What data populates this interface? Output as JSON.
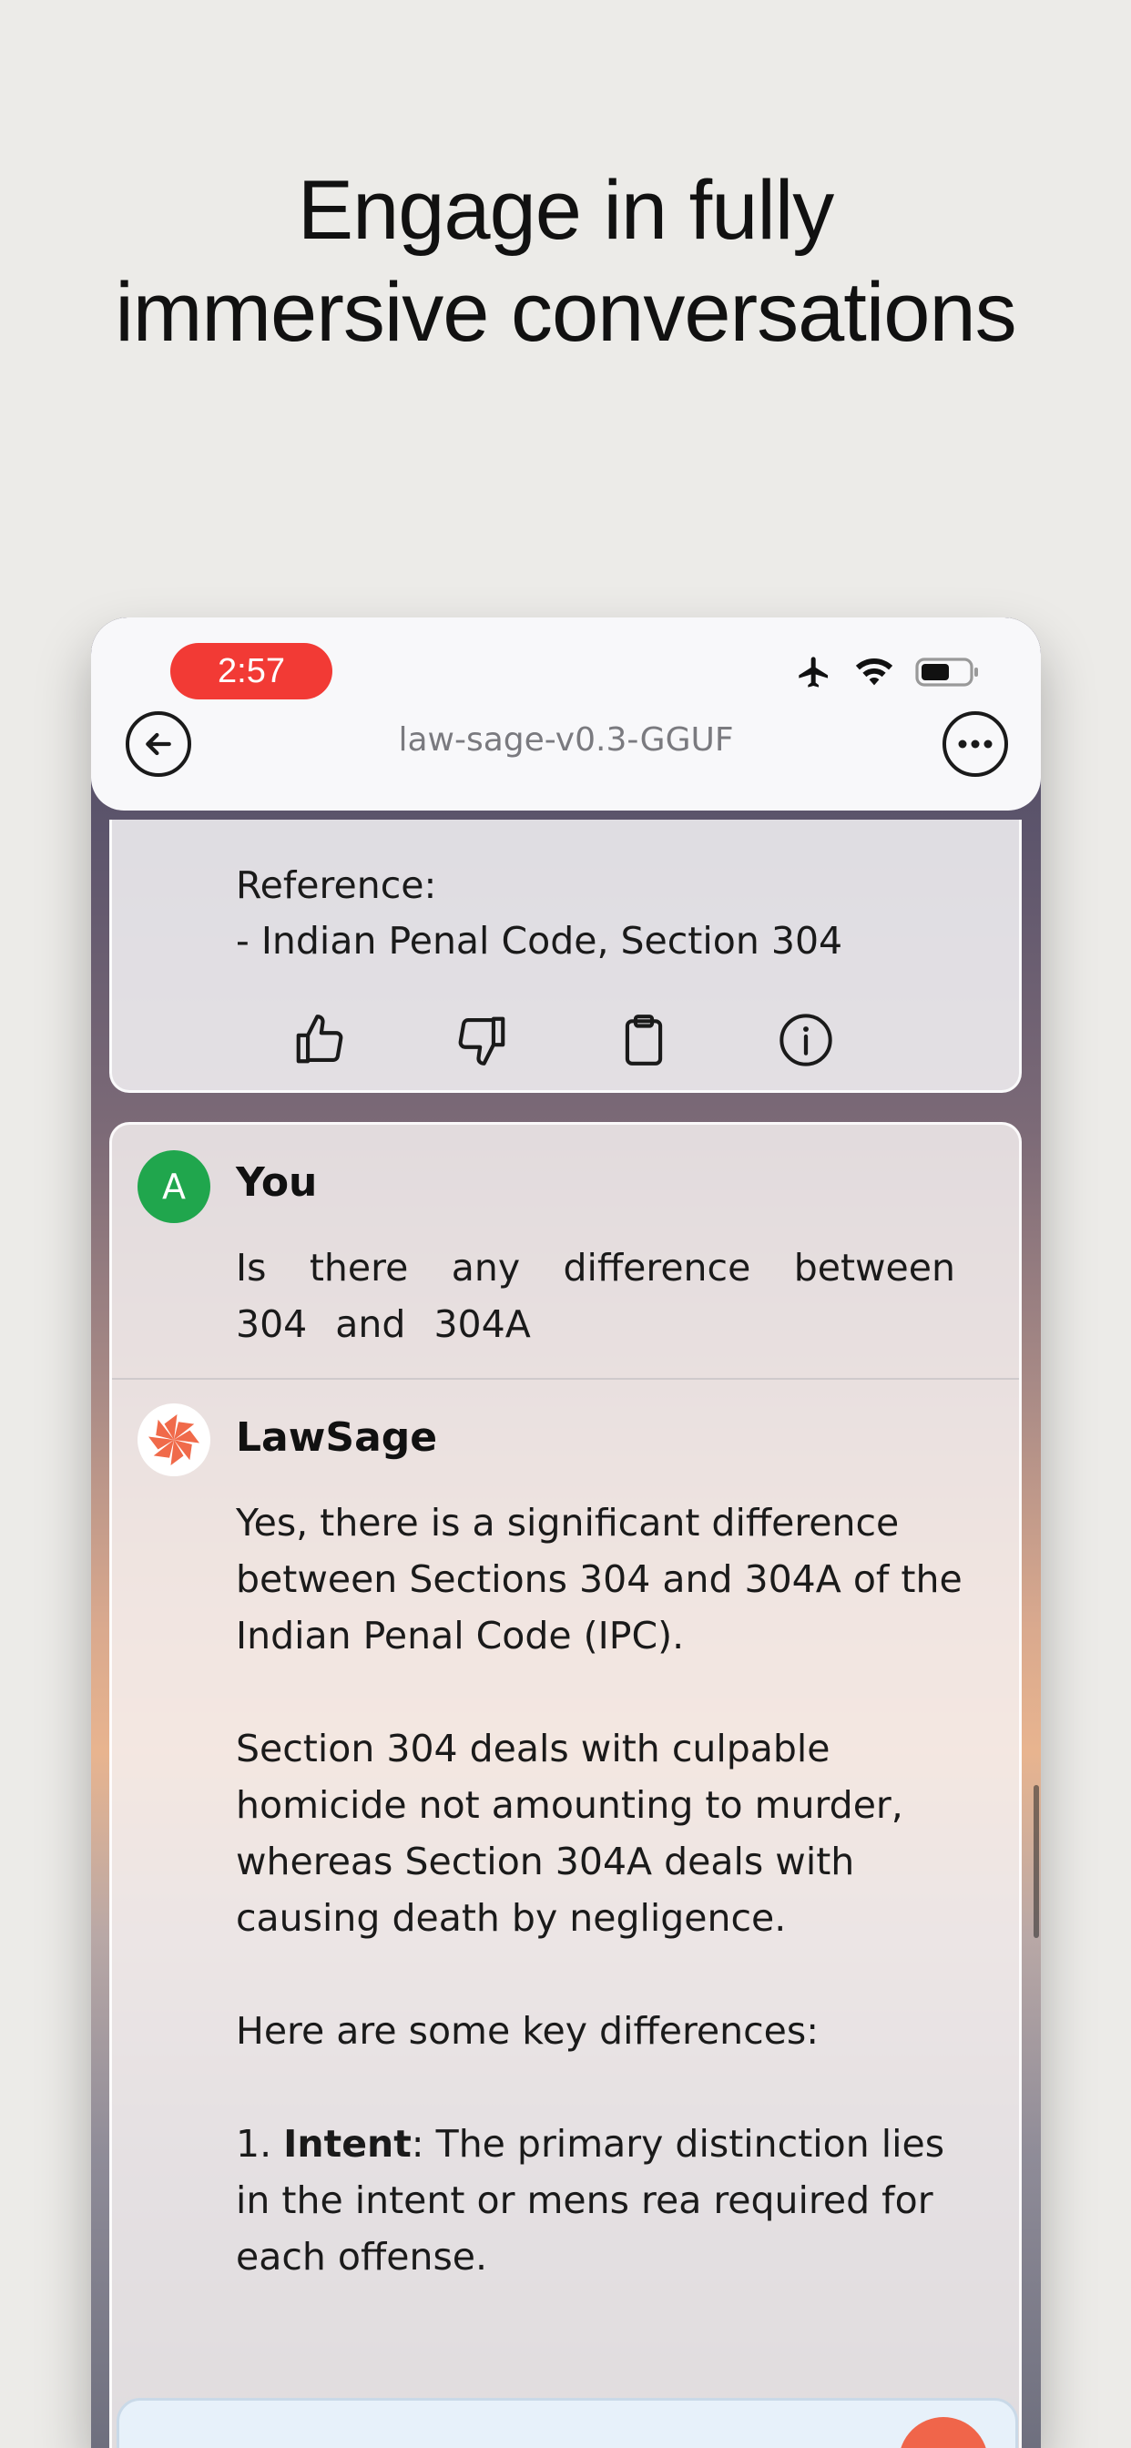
{
  "headline": {
    "line1": "Engage in fully",
    "line2": "immersive conversations"
  },
  "status_bar": {
    "time": "2:57",
    "icons": [
      "airplane-icon",
      "wifi-icon",
      "battery-icon"
    ]
  },
  "nav": {
    "title": "law-sage-v0.3-GGUF",
    "back_icon": "back-arrow-icon",
    "more_icon": "more-icon"
  },
  "previous_message": {
    "reference_label": "Reference:",
    "reference_item": "- Indian Penal Code, Section 304",
    "actions": [
      "thumbs-up-icon",
      "thumbs-down-icon",
      "clipboard-icon",
      "info-icon"
    ]
  },
  "messages": {
    "user": {
      "avatar_letter": "A",
      "name": "You",
      "text": "Is there any difference between 304 and 304A"
    },
    "bot": {
      "name": "LawSage",
      "p1": "Yes, there is a significant difference between Sections 304 and 304A of the Indian Penal Code (IPC).",
      "p2": "Section 304 deals with culpable homicide not amounting to murder, whereas Section 304A deals with causing death by negligence.",
      "p3": "Here are some key differences:",
      "p4_prefix": "1. ",
      "p4_bold": "Intent",
      "p4_rest": ": The primary distinction lies in the intent or mens rea required for each offense."
    }
  },
  "colors": {
    "accent": "#f23a35",
    "user_avatar": "#20a64d",
    "send_button": "#f0654a"
  }
}
